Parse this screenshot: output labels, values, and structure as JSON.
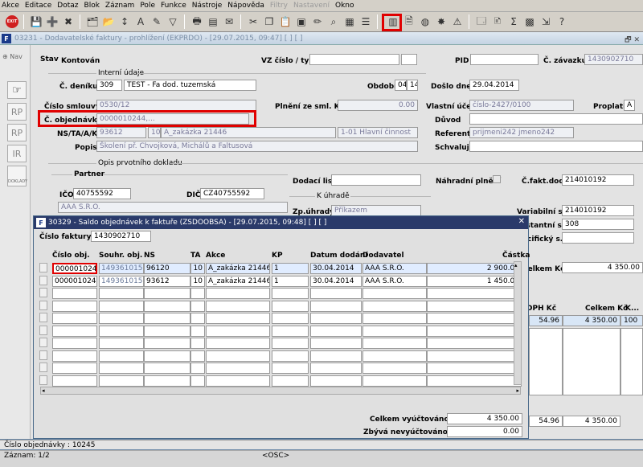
{
  "menu": [
    "Akce",
    "Editace",
    "Dotaz",
    "Blok",
    "Záznam",
    "Pole",
    "Funkce",
    "Nástroje",
    "Nápověda",
    "Filtry",
    "Nastavení",
    "Okno"
  ],
  "menu_disabled": [
    "Filtry",
    "Nastavení"
  ],
  "toolbar": {
    "exit_label": "EXIT"
  },
  "main_window": {
    "title": "03231 - Dodavatelské faktury - prohlížení (EKPRDO) - [29.07.2015, 09:47] [ ] [ ]",
    "nav_label": "Nav",
    "nav_buttons": [
      "RP",
      "RP",
      "IR",
      "DOKLADY"
    ],
    "stav_label": "Stav",
    "stav_value": "Kontován",
    "vz_label": "VZ číslo / typ",
    "pid_label": "PID",
    "c_zavazku_label": "Č. závazku",
    "c_zavazku_value": "1430902710",
    "interni_udaje": "Interní údaje",
    "c_deniku_label": "Č. deníku",
    "c_deniku_value": "309",
    "denik_name": "TEST - Fa dod. tuzemská",
    "obdobi_label": "Období",
    "obdobi_1": "04",
    "obdobi_2": "14",
    "doslo_label": "Došlo dne",
    "doslo_value": "29.04.2014",
    "cislo_smlouvy_label": "Číslo smlouvy",
    "cislo_smlouvy_value": "0530/12",
    "plneni_label": "Plnění ze sml. Kč",
    "plneni_value": "0.00",
    "vlastni_ucet_label": "Vlastní účet",
    "vlastni_ucet_value": "číslo-2427/0100",
    "proplatit_label": "Proplatit",
    "proplatit_value": "A",
    "c_objednavky_label": "Č. objednávky",
    "c_objednavky_value": "0000010244,...",
    "duvod_label": "Důvod",
    "ns_label": "NS/TA/A/KP",
    "ns_value": "93612",
    "ta_value": "10",
    "akce_value": "A_zakázka 21446",
    "kp_value": "1-01 Hlavní činnost",
    "referent_label": "Referent",
    "referent_value": "prijmeni242 jmeno242",
    "popis_label": "Popis",
    "popis_value": "Školení př. Chvojková, Michálů a Faltusová",
    "schvaluje_label": "Schvaluje",
    "opis_label": "Opis prvotního dokladu",
    "partner_label": "Partner",
    "dodaci_list_label": "Dodací list",
    "nahradni_label": "Náhradní plnění",
    "c_fakt_dod_label": "Č.fakt.dod.",
    "c_fakt_dod_value": "214010192",
    "ico_label": "IČO",
    "ico_value": "40755592",
    "dic_label": "DIČ",
    "dic_value": "CZ40755592",
    "k_uhrade_label": "K úhradě",
    "partner_name": "AAA S.R.O.",
    "zp_uhrady_label": "Zp.úhrady",
    "zp_uhrady_value": "Příkazem",
    "variabilni_label": "Variabilní s.",
    "variabilni_value": "214010192",
    "konstantni_label": "Konstantní s.",
    "konstantni_value": "308",
    "specificky_label": "Specifický s.",
    "celkem_kc_label": "Celkem Kč",
    "celkem_kc_value": "4 350.00",
    "dph_kc_label": "DPH Kč",
    "celkem_kc2_label": "Celkem Kč",
    "k_label": "K...",
    "dph_row_value": "54.96",
    "celkem_row_value": "4 350.00",
    "k_row_value": "100",
    "bottom_dph": "54.96",
    "bottom_celkem": "4 350.00"
  },
  "dialog": {
    "title": "30329 - Saldo objednávek k faktuře (ZSDOOBSA) - [29.07.2015, 09:48] [ ] [ ]",
    "cislo_faktury_label": "Číslo faktury:",
    "cislo_faktury_value": "1430902710",
    "columns": [
      "Číslo obj.",
      "Souhr. obj.",
      "NS",
      "TA",
      "Akce",
      "KP",
      "Datum dodání",
      "Dodavatel",
      "Částka"
    ],
    "rows": [
      [
        "0000010245",
        "1493610150",
        "96120",
        "10",
        "A_zakázka 21446",
        "1",
        "30.04.2014",
        "AAA S.R.O.",
        "2 900.00"
      ],
      [
        "0000010244",
        "1493610150",
        "93612",
        "10",
        "A_zakázka 21446",
        "1",
        "30.04.2014",
        "AAA S.R.O.",
        "1 450.00"
      ]
    ],
    "celkem_vyuctovano_label": "Celkem vyúčtováno",
    "celkem_vyuctovano_value": "4 350.00",
    "zbyva_label": "Zbývá nevyúčtováno",
    "zbyva_value": "0.00"
  },
  "status": {
    "line1": "Číslo objednávky : 10245",
    "line2": "Záznam: 1/2",
    "osc": "<OSC>"
  }
}
